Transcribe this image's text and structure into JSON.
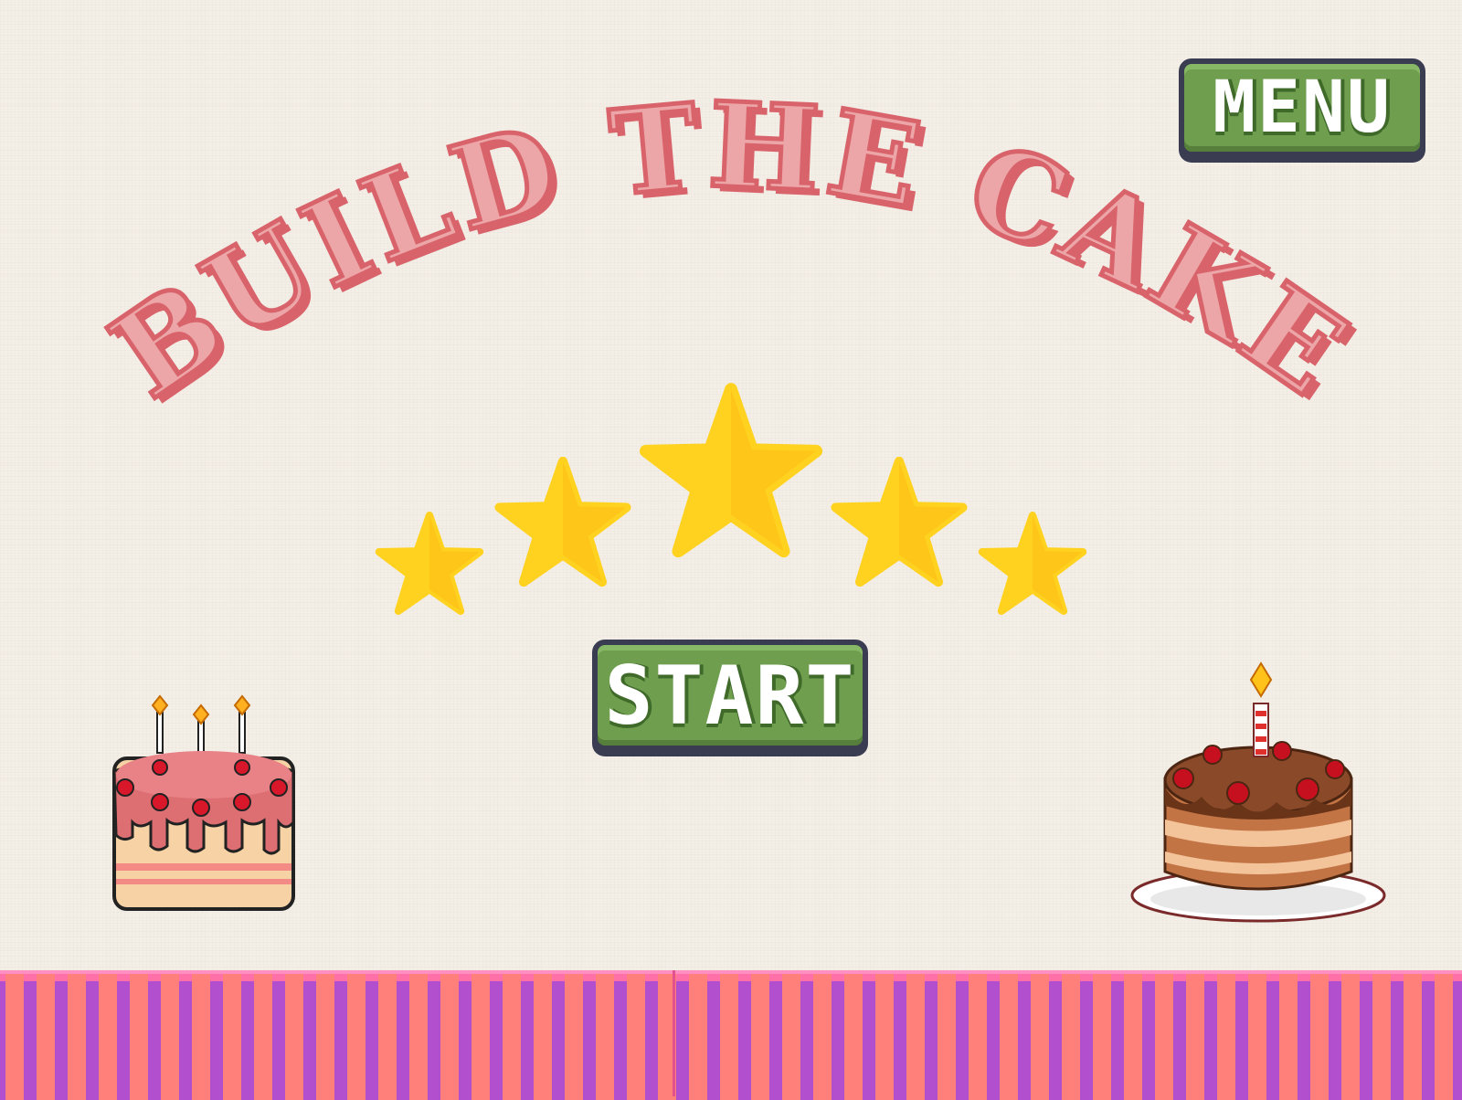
{
  "title": "BUILD THE CAKE",
  "menu_label": "MENU",
  "start_label": "START",
  "rating": {
    "stars": 5,
    "max": 5
  },
  "colors": {
    "title_fill": "#eca6a8",
    "title_outline": "#d9636b",
    "button_green": "#6f9e4f",
    "button_border": "#3a3d52",
    "star_yellow": "#ffd21f",
    "floor_purple": "#b24fcf",
    "floor_pink": "#ff7f7a"
  },
  "icons": {
    "left_cake": "strawberry-cake-icon",
    "right_cake": "chocolate-cake-icon",
    "star": "star-icon"
  }
}
